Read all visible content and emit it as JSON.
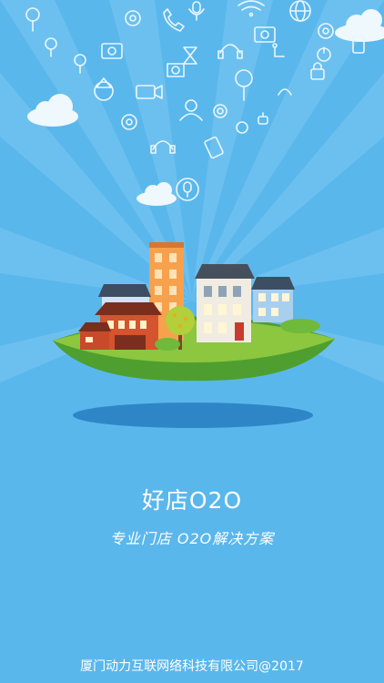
{
  "splash": {
    "app_name": "好店O2O",
    "tagline": "专业门店  O2O解决方案",
    "copyright": "厦门动力互联网络科技有限公司@2017"
  },
  "colors": {
    "sky": "#5ab7ec",
    "ray": "#7cc8f2",
    "cloud": "#eef8fd",
    "island_grass": "#8dc63f",
    "island_shadow": "#2f86c7",
    "text": "#ffffff"
  },
  "icons": [
    "lollipop-icon",
    "gear-icon",
    "phone-icon",
    "microphone-icon",
    "wifi-icon",
    "globe-icon",
    "thumb-icon",
    "camera-icon",
    "hourglass-icon",
    "headphones-icon",
    "camera-icon",
    "tablet-icon",
    "medal-icon",
    "usb-icon",
    "recycle-icon",
    "video-camera-icon",
    "speaker-icon",
    "user-icon",
    "ball-icon",
    "padlock-icon",
    "power-icon",
    "chip-icon",
    "sun-icon",
    "headset-icon",
    "joystick-icon",
    "mobile-icon",
    "microphone-icon"
  ]
}
